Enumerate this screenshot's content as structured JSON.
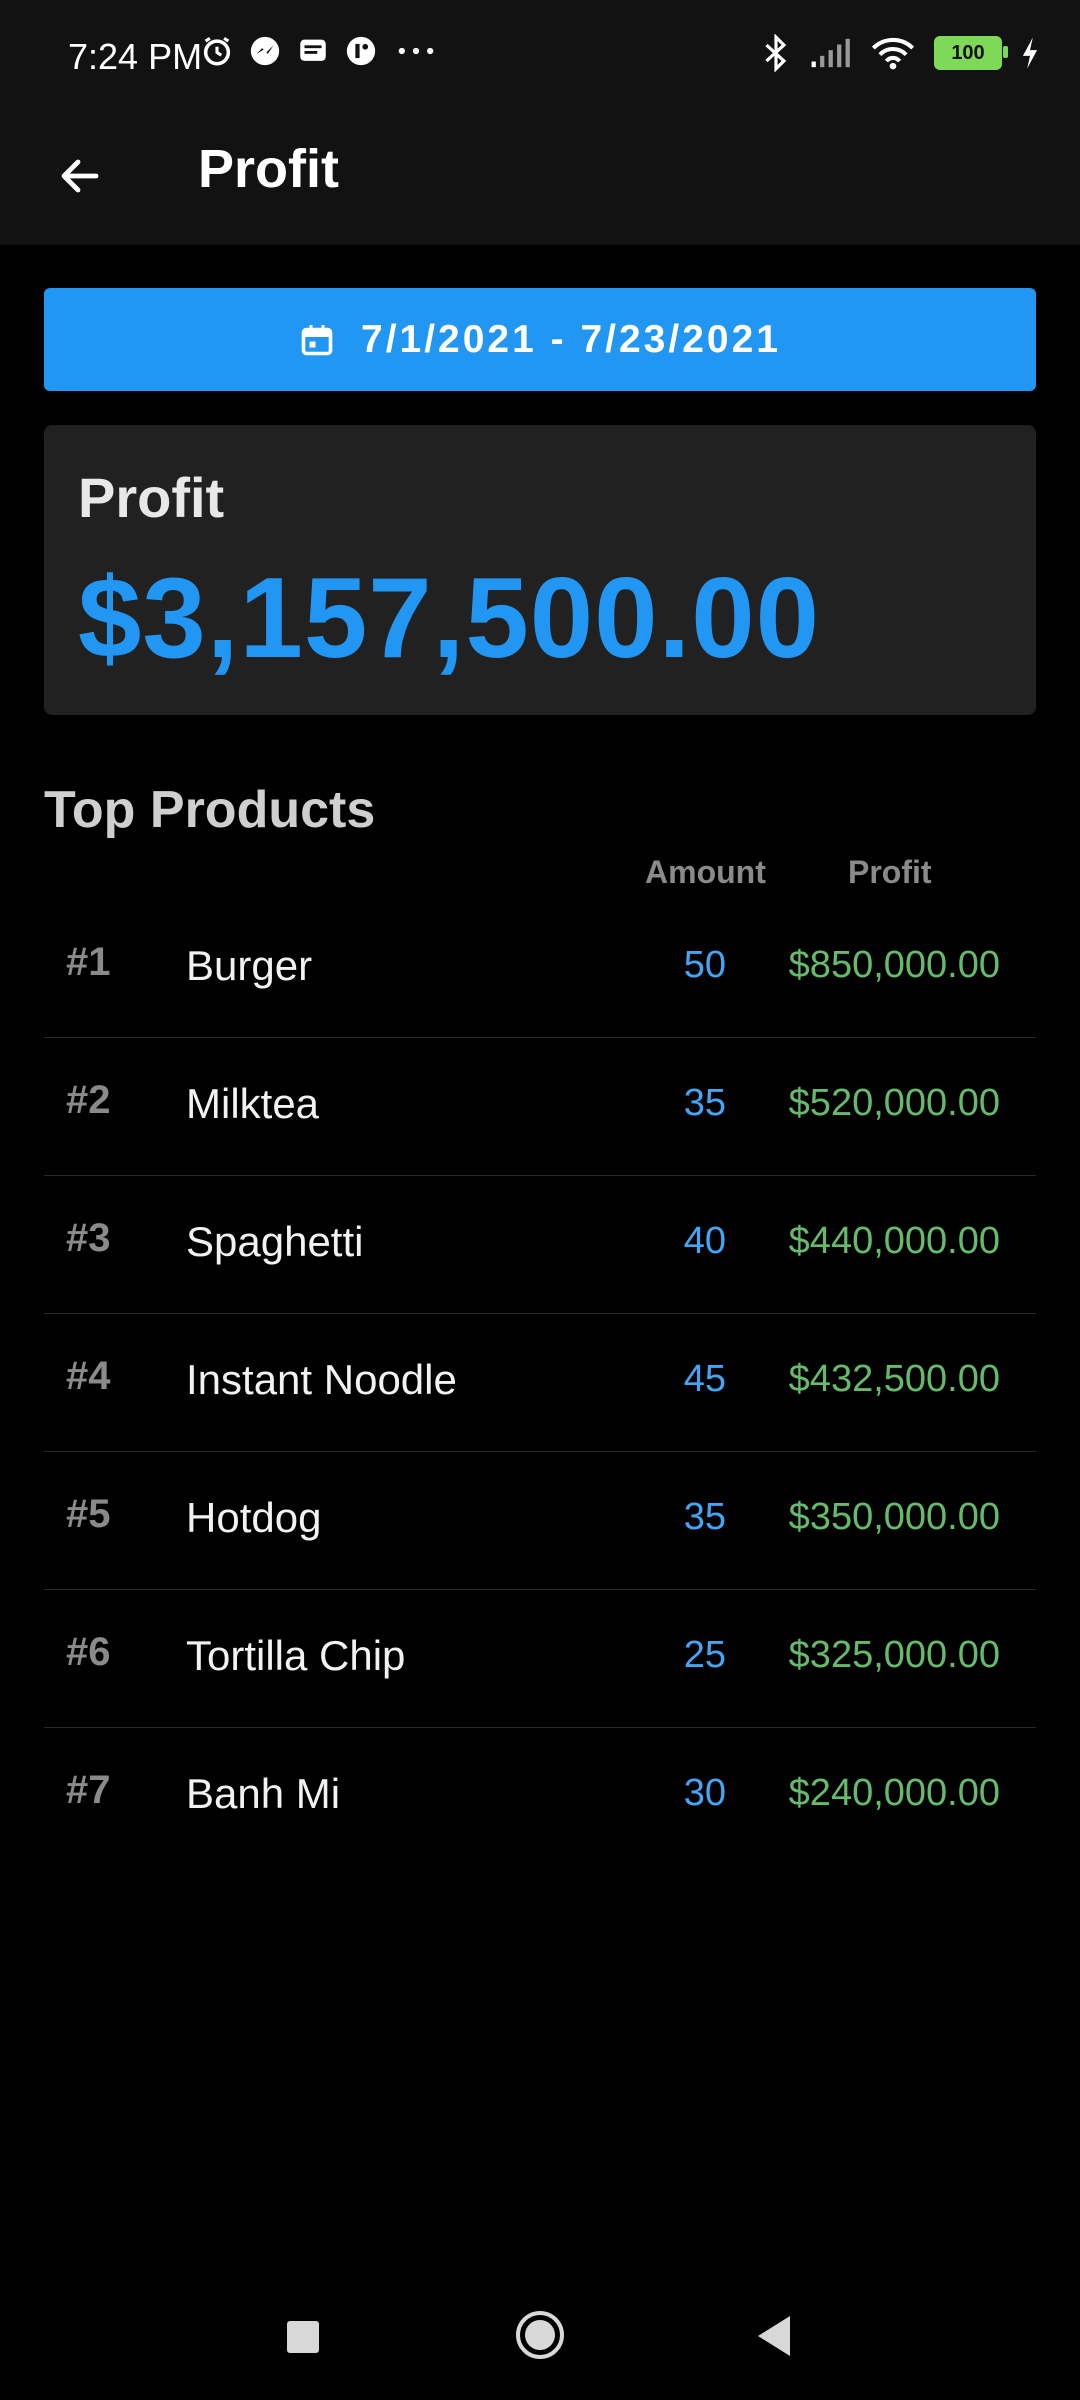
{
  "status_bar": {
    "time": "7:24 PM",
    "left_icons": [
      "alarm-icon",
      "messenger-icon",
      "message-icon",
      "app-icon",
      "more-dots-icon"
    ],
    "right_icons": [
      "bluetooth-icon",
      "signal-icon",
      "wifi-icon",
      "battery-icon",
      "charging-icon"
    ],
    "battery": "100"
  },
  "app_bar": {
    "title": "Profit"
  },
  "date_range": {
    "label": "7/1/2021 - 7/23/2021"
  },
  "summary": {
    "label": "Profit",
    "value": "$3,157,500.00"
  },
  "top_products": {
    "title": "Top Products",
    "columns": {
      "amount": "Amount",
      "profit": "Profit"
    },
    "rows": [
      {
        "rank": "#1",
        "name": "Burger",
        "amount": "50",
        "profit": "$850,000.00"
      },
      {
        "rank": "#2",
        "name": "Milktea",
        "amount": "35",
        "profit": "$520,000.00"
      },
      {
        "rank": "#3",
        "name": "Spaghetti",
        "amount": "40",
        "profit": "$440,000.00"
      },
      {
        "rank": "#4",
        "name": "Instant Noodle",
        "amount": "45",
        "profit": "$432,500.00"
      },
      {
        "rank": "#5",
        "name": "Hotdog",
        "amount": "35",
        "profit": "$350,000.00"
      },
      {
        "rank": "#6",
        "name": "Tortilla Chip",
        "amount": "25",
        "profit": "$325,000.00"
      },
      {
        "rank": "#7",
        "name": "Banh Mi",
        "amount": "30",
        "profit": "$240,000.00"
      }
    ]
  },
  "colors": {
    "accent": "#2196f3",
    "amount": "#42a5f5",
    "profit": "#66bb6a",
    "card": "#212121",
    "background": "#000000"
  }
}
